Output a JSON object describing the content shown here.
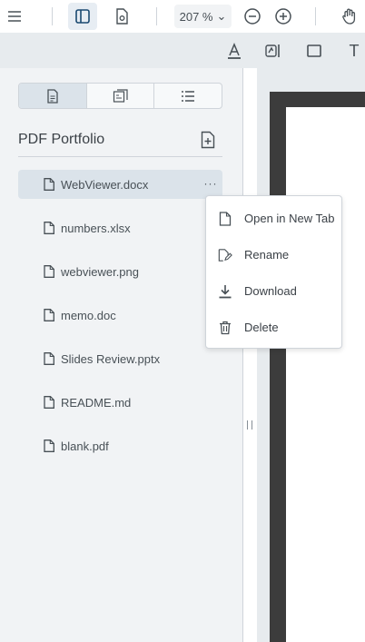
{
  "toolbar": {
    "zoom_value": "207 %",
    "zoom_caret": "⌄",
    "icons": [
      "menu-icon",
      "panel-toggle-icon",
      "settings-doc-icon",
      "zoom-out-icon",
      "zoom-in-icon",
      "pan-hand-icon"
    ]
  },
  "annotation_toolbar": {
    "icons": [
      "text-underline-icon",
      "signature-icon",
      "rectangle-icon",
      "free-text-icon"
    ],
    "free_text_glyph": "T"
  },
  "left_panel": {
    "tabs": [
      {
        "name": "thumbnails",
        "icon": "page-icon",
        "active": true
      },
      {
        "name": "outlines",
        "icon": "outline-icon",
        "active": false
      },
      {
        "name": "list",
        "icon": "list-icon",
        "active": false
      }
    ],
    "portfolio_title": "PDF Portfolio",
    "files": [
      {
        "name": "WebViewer.docx",
        "selected": true
      },
      {
        "name": "numbers.xlsx",
        "selected": false
      },
      {
        "name": "webviewer.png",
        "selected": false
      },
      {
        "name": "memo.doc",
        "selected": false
      },
      {
        "name": "Slides Review.pptx",
        "selected": false
      },
      {
        "name": "README.md",
        "selected": false
      },
      {
        "name": "blank.pdf",
        "selected": false
      }
    ],
    "more_label": "···"
  },
  "context_menu": {
    "items": [
      {
        "label": "Open in New Tab",
        "icon": "file-icon"
      },
      {
        "label": "Rename",
        "icon": "rename-icon"
      },
      {
        "label": "Download",
        "icon": "download-icon"
      },
      {
        "label": "Delete",
        "icon": "trash-icon"
      }
    ]
  },
  "colors": {
    "accent": "#dbe3ea",
    "panel_bg": "#f1f3f5",
    "icon": "#485056",
    "active_icon": "#1a4971"
  }
}
